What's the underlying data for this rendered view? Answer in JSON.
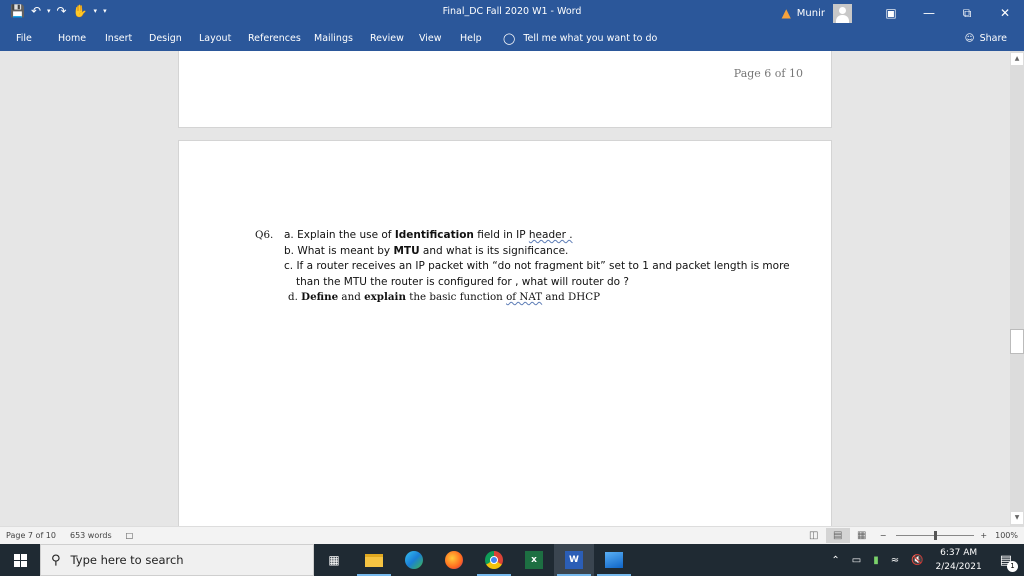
{
  "titlebar": {
    "title": "Final_DC Fall 2020 W1  -  Word",
    "user": "Munir",
    "qat_icons": [
      "save-icon",
      "undo-icon",
      "redo-icon",
      "touch-mode-icon",
      "customize-qat-icon"
    ]
  },
  "ribbon": {
    "tabs": [
      "File",
      "Home",
      "Insert",
      "Design",
      "Layout",
      "References",
      "Mailings",
      "Review",
      "View",
      "Help"
    ],
    "tell_me": "Tell me what you want to do",
    "share": "Share"
  },
  "document": {
    "prev_page_footer": "Page 6 of 10",
    "question": {
      "number": "Q6.",
      "a": {
        "pre": "a. Explain the use of ",
        "bold": "Identification",
        "post": " field in IP ",
        "squig": "header .",
        "end": ""
      },
      "b": {
        "pre": "b. What is meant by ",
        "bold": "MTU",
        "post": " and what is its significance."
      },
      "c1": "c. If a router receives an IP packet with “do not fragment bit” set to 1 and packet length is more",
      "c2": "than the MTU the router is configured for , what will router do ?",
      "d": {
        "pre": "d. ",
        "bold1": "Define",
        "mid1": " and ",
        "bold2": "explain",
        "mid2": " the basic function ",
        "squig": "of  NAT",
        "post": " and DHCP"
      }
    }
  },
  "statusbar": {
    "page": "Page 7 of 10",
    "words": "653 words",
    "zoom": "100%",
    "zoom_level_percent": 100
  },
  "taskbar": {
    "search_placeholder": "Type here to search",
    "time": "6:37 AM",
    "date": "2/24/2021",
    "notification_count": "1"
  }
}
